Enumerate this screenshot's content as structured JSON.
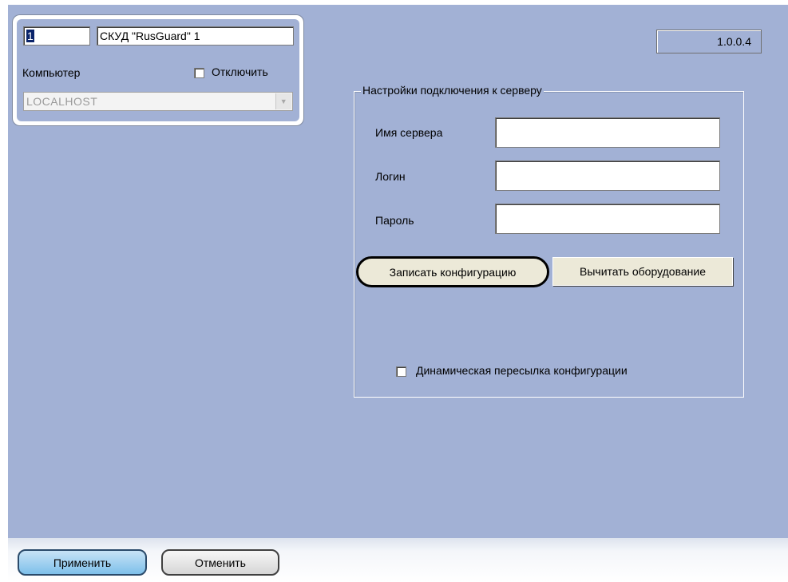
{
  "card": {
    "id_value": "1",
    "name_value": "СКУД \"RusGuard\" 1",
    "computer_label": "Компьютер",
    "disable_label": "Отключить",
    "computer_value": "LOCALHOST"
  },
  "version": "1.0.0.4",
  "server_group": {
    "title": "Настройки подключения к серверу",
    "server_name_label": "Имя сервера",
    "server_name_value": "",
    "login_label": "Логин",
    "login_value": "",
    "password_label": "Пароль",
    "password_value": "",
    "write_config_button": "Записать конфигурацию",
    "read_hardware_button": "Вычитать оборудование",
    "dynamic_sync_label": "Динамическая пересылка конфигурации"
  },
  "footer": {
    "apply_button": "Применить",
    "cancel_button": "Отменить"
  }
}
